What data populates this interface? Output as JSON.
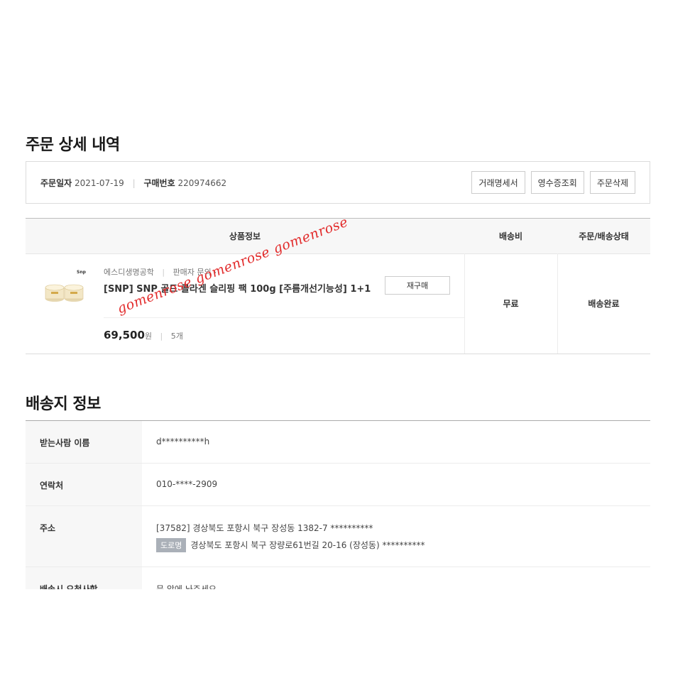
{
  "section1": {
    "title": "주문 상세 내역"
  },
  "order": {
    "date_label": "주문일자",
    "date": "2021-07-19",
    "number_label": "구매번호",
    "number": "220974662",
    "buttons": [
      "거래명세서",
      "영수증조회",
      "주문삭제"
    ]
  },
  "table": {
    "headers": {
      "info": "상품정보",
      "shipping_fee": "배송비",
      "status": "주문/배송상태"
    }
  },
  "product": {
    "brand": "에스디생명공학",
    "seller_inquiry": "판매자 문의",
    "name": "[SNP] SNP 골드 콜라겐 슬리핑 팩 100g [주름개선기능성] 1+1",
    "rebuy_label": "재구매",
    "price": "69,500",
    "currency": "원",
    "quantity": "5개",
    "shipping_fee": "무료",
    "status": "배송완료",
    "thumb_brand": "Snp"
  },
  "watermark": "gomenrose gomenrose gomenrose",
  "section2": {
    "title": "배송지 정보"
  },
  "shipping": {
    "recipient_label": "받는사람 이름",
    "recipient": "d**********h",
    "contact_label": "연락처",
    "contact": "010-****-2909",
    "address_label": "주소",
    "address_jibun": "[37582] 경상북도 포항시 북구 장성동 1382-7 **********",
    "road_tag": "도로명",
    "address_road": "경상북도 포항시 북구 장량로61번길 20-16 (장성동) **********",
    "request_label": "배송시 요청사항",
    "request": "문 앞에 놔주세요"
  }
}
